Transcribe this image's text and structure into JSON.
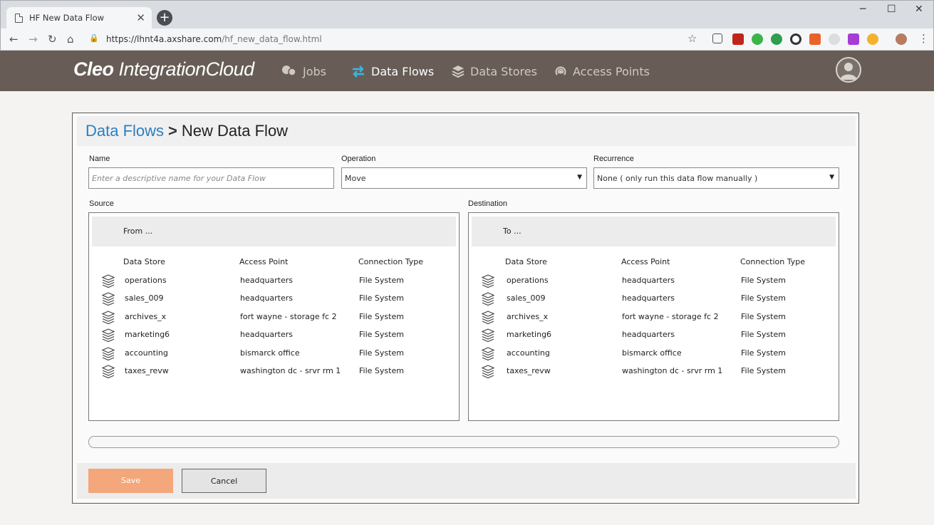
{
  "browser": {
    "tab_title": "HF New Data Flow",
    "tab_close": "✕",
    "new_tab": "+",
    "url_host": "https://lhnt4a.axshare.com",
    "url_path": "/hf_new_data_flow.html",
    "minimize": "─",
    "maximize": "☐",
    "close": "✕"
  },
  "app": {
    "brand_bold": "Cleo",
    "brand_rest": " IntegrationCloud",
    "nav": [
      {
        "label": "Jobs",
        "icon": "jobs-icon"
      },
      {
        "label": "Data Flows",
        "icon": "data-flows-icon"
      },
      {
        "label": "Data Stores",
        "icon": "data-stores-icon"
      },
      {
        "label": "Access Points",
        "icon": "access-points-icon"
      }
    ],
    "active_nav": "Data Flows",
    "accent": "#2b7fbf",
    "header_color": "#675d56"
  },
  "page": {
    "crumb_link": "Data Flows",
    "crumb_sep": ">",
    "crumb_current": "New Data Flow"
  },
  "form": {
    "name_label": "Name",
    "name_placeholder": "Enter a descriptive name for your Data Flow",
    "operation_label": "Operation",
    "operation_value": "Move",
    "recurrence_label": "Recurrence",
    "recurrence_value": "None ( only run this data flow manually )",
    "caret": "▼"
  },
  "source": {
    "label": "Source",
    "header": "From ...",
    "columns": [
      "Data Store",
      "Access Point",
      "Connection Type"
    ],
    "rows": [
      [
        "operations",
        "headquarters",
        "File System"
      ],
      [
        "sales_009",
        "headquarters",
        "File System"
      ],
      [
        "archives_x",
        "fort wayne - storage fc 2",
        "File System"
      ],
      [
        "marketing6",
        "headquarters",
        "File System"
      ],
      [
        "accounting",
        "bismarck office",
        "File System"
      ],
      [
        "taxes_revw",
        "washington dc - srvr rm 1",
        "File System"
      ]
    ]
  },
  "destination": {
    "label": "Destination",
    "header": "To ...",
    "columns": [
      "Data Store",
      "Access Point",
      "Connection Type"
    ],
    "rows": [
      [
        "operations",
        "headquarters",
        "File System"
      ],
      [
        "sales_009",
        "headquarters",
        "File System"
      ],
      [
        "archives_x",
        "fort wayne - storage fc 2",
        "File System"
      ],
      [
        "marketing6",
        "headquarters",
        "File System"
      ],
      [
        "accounting",
        "bismarck office",
        "File System"
      ],
      [
        "taxes_revw",
        "washington dc - srvr rm 1",
        "File System"
      ]
    ]
  },
  "actions": {
    "save": "Save",
    "cancel": "Cancel",
    "save_color": "#f3a77a"
  }
}
